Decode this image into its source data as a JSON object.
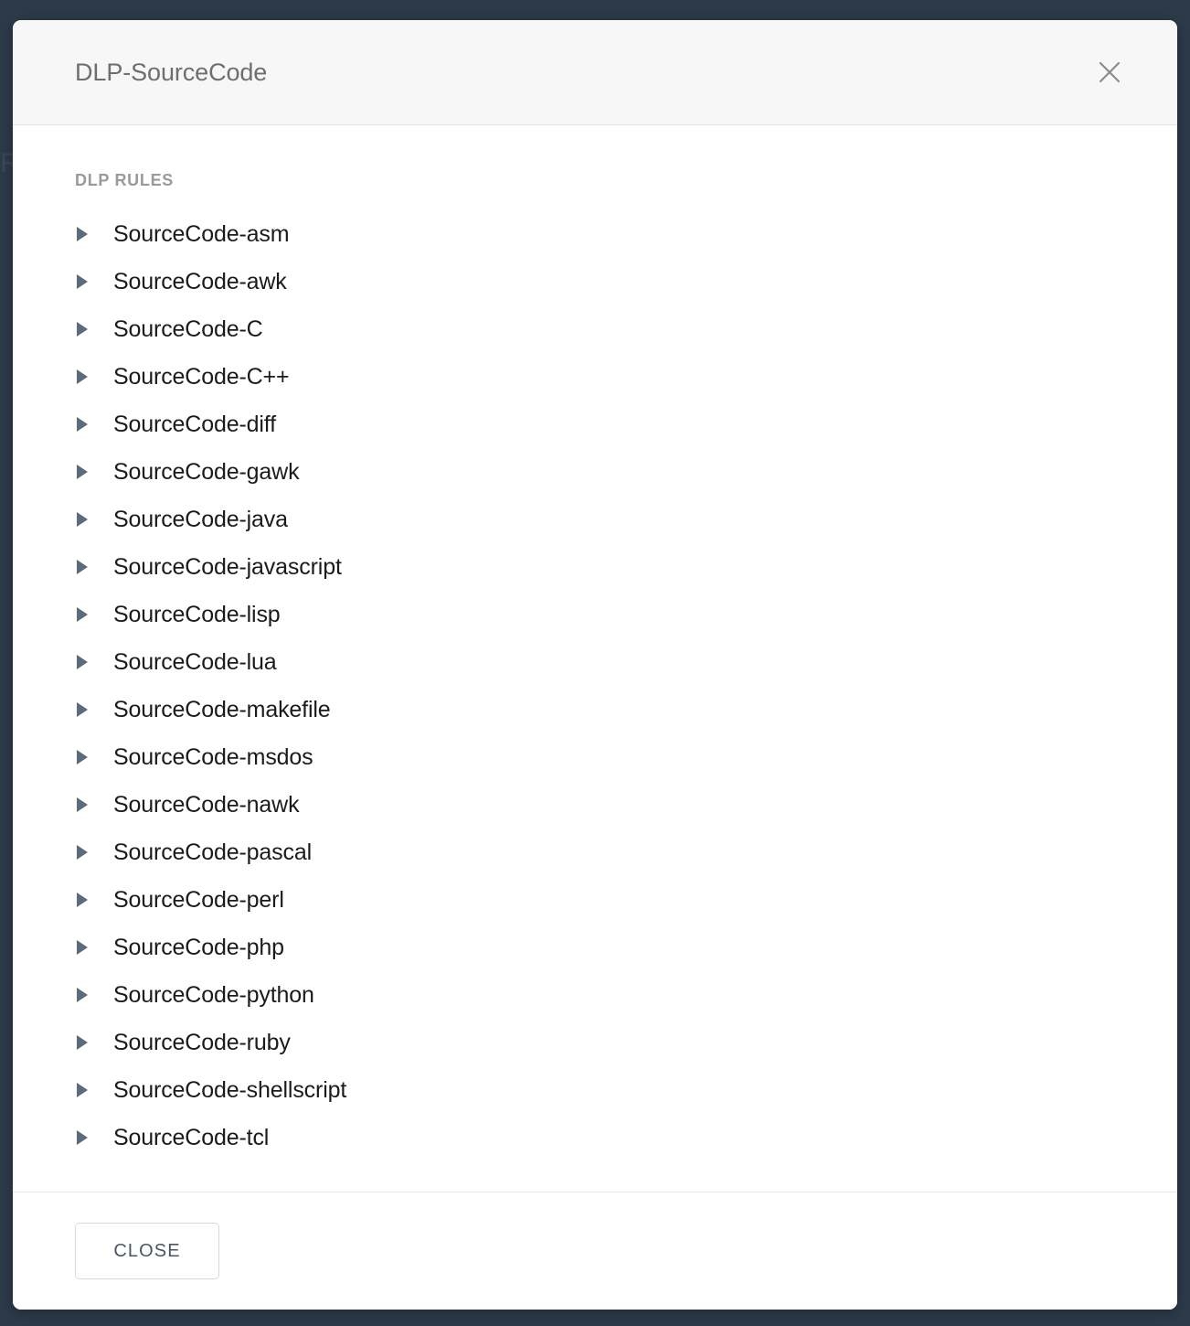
{
  "backdrop": {
    "obscured_text": "R",
    "color": "#2d3a49"
  },
  "modal": {
    "title": "DLP-SourceCode",
    "close_icon": "close-icon",
    "body": {
      "section_label": "DLP RULES",
      "caret_icon": "triangle-right-icon",
      "caret_color": "#5b6b7b",
      "rules": [
        {
          "label": "SourceCode-asm"
        },
        {
          "label": "SourceCode-awk"
        },
        {
          "label": "SourceCode-C"
        },
        {
          "label": "SourceCode-C++"
        },
        {
          "label": "SourceCode-diff"
        },
        {
          "label": "SourceCode-gawk"
        },
        {
          "label": "SourceCode-java"
        },
        {
          "label": "SourceCode-javascript"
        },
        {
          "label": "SourceCode-lisp"
        },
        {
          "label": "SourceCode-lua"
        },
        {
          "label": "SourceCode-makefile"
        },
        {
          "label": "SourceCode-msdos"
        },
        {
          "label": "SourceCode-nawk"
        },
        {
          "label": "SourceCode-pascal"
        },
        {
          "label": "SourceCode-perl"
        },
        {
          "label": "SourceCode-php"
        },
        {
          "label": "SourceCode-python"
        },
        {
          "label": "SourceCode-ruby"
        },
        {
          "label": "SourceCode-shellscript"
        },
        {
          "label": "SourceCode-tcl"
        }
      ]
    },
    "footer": {
      "close_label": "CLOSE"
    }
  }
}
